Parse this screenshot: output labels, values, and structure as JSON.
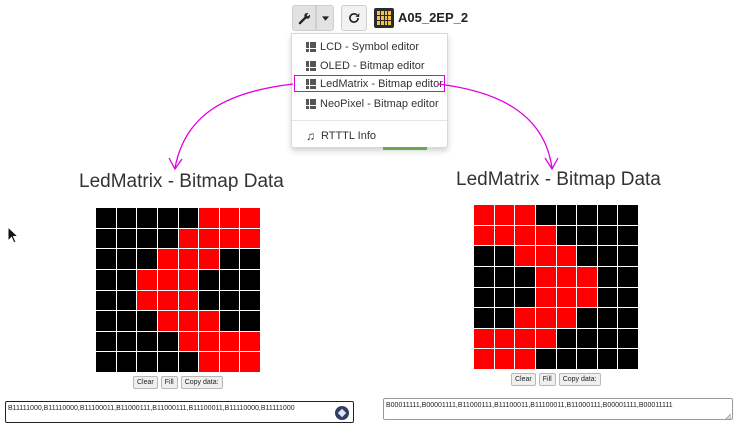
{
  "toolbar": {
    "tools_icon": "wrench-icon",
    "caret_icon": "caret-down-icon",
    "refresh_icon": "refresh-icon",
    "board_icon": "microbit-board-icon",
    "board_name": "A05_2EP_2"
  },
  "menu": {
    "items": [
      {
        "label": "LCD - Symbol editor",
        "icon": "grid-icon"
      },
      {
        "label": "OLED - Bitmap editor",
        "icon": "grid-icon"
      },
      {
        "label": "LedMatrix - Bitmap editor",
        "icon": "grid-icon",
        "highlighted": true
      },
      {
        "label": "NeoPixel - Bitmap editor",
        "icon": "grid-icon"
      },
      {
        "label": "RTTTL Info",
        "icon": "music-note-icon"
      }
    ],
    "highlight_color": "#e000e0"
  },
  "colors": {
    "led_on": "#000000",
    "led_off": "#ff0000",
    "arrow": "#e000e0"
  },
  "panels": [
    {
      "title": "LedMatrix - Bitmap Data",
      "rows": [
        "11111000",
        "11110000",
        "11100011",
        "11000111",
        "11000111",
        "11100011",
        "11110000",
        "11111000"
      ],
      "buttons": [
        "Clear",
        "Fill",
        "Copy data:"
      ],
      "data_text": "B11111000,B11110000,B11100011,B11000111,B11000111,B11100011,B11110000,B11111000"
    },
    {
      "title": "LedMatrix - Bitmap Data",
      "rows": [
        "00011111",
        "00001111",
        "11000111",
        "11100011",
        "11100011",
        "11000111",
        "00001111",
        "00011111"
      ],
      "buttons": [
        "Clear",
        "Fill",
        "Copy data:"
      ],
      "data_text": "B00011111,B00001111,B11000111,B11100011,B11100011,B11000111,B00001111,B00011111"
    }
  ]
}
